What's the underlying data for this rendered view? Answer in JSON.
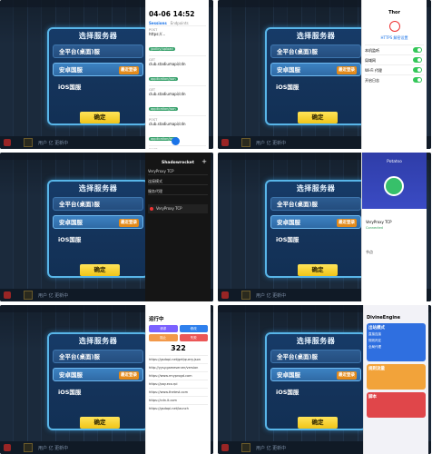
{
  "game": {
    "dialog_title": "选择服务器",
    "options": [
      "全平台(桌面)服",
      "安卓国服",
      "iOS国服"
    ],
    "selected_badge": "最近登录",
    "confirm": "确定",
    "bottom_text": "用户 亿 更新中"
  },
  "panel1": {
    "time": "04-06 14:52",
    "tab_a": "Sessions",
    "tab_b": "Endpoints",
    "rows": [
      {
        "method": "POST",
        "path": "https://...",
        "label": "/policy/upload"
      },
      {
        "method": "GET",
        "path": "club.stadiumapi/cdn",
        "label": "application/json"
      },
      {
        "method": "GET",
        "path": "club.stadiumapi/cdn",
        "label": "application/json"
      },
      {
        "method": "POST",
        "path": "club.stadiumapi/cdn",
        "label": "application/json"
      },
      {
        "method": "POST",
        "path": "/portal/sample.login.login",
        "label": "application/json"
      }
    ]
  },
  "panel2": {
    "title": "Thor",
    "section": "HTTPS 解密设置",
    "toggles": [
      "本机监听",
      "局域网",
      "Wi-Fi 代理",
      "开启日志"
    ]
  },
  "panel3": {
    "title": "Shadowrocket",
    "items": [
      "VeryProxy TCP",
      "连接模式",
      "服务代理"
    ],
    "node": "VeryProxy TCP",
    "add": "+"
  },
  "panel4": {
    "brand": "Potatso",
    "node_name": "VeryProxy TCP",
    "status": "Connected",
    "footer": "节点"
  },
  "panel5": {
    "title": "运行中",
    "count": "322",
    "tiles": [
      "请求",
      "修改",
      "阻止",
      "失败"
    ],
    "urls": [
      "https://gsdapi.net/get/query.json",
      "http://yysy.gameserver/version",
      "https://www.rmyprogd.com",
      "https://pay.eco.rpi",
      "https://www.thetest.com",
      "https://cdn.it.com",
      "https://gsdapi.net/launch"
    ]
  },
  "panel6": {
    "title": "DivineEngine",
    "cards": [
      "出站模式",
      "规则流量",
      "脚本"
    ],
    "opts": [
      "直接连接",
      "规则判定",
      "全局代理"
    ]
  },
  "colors": {
    "accent_blue": "#58b5e8",
    "confirm_yellow": "#f0c418",
    "badge_orange": "#e38a1a"
  }
}
